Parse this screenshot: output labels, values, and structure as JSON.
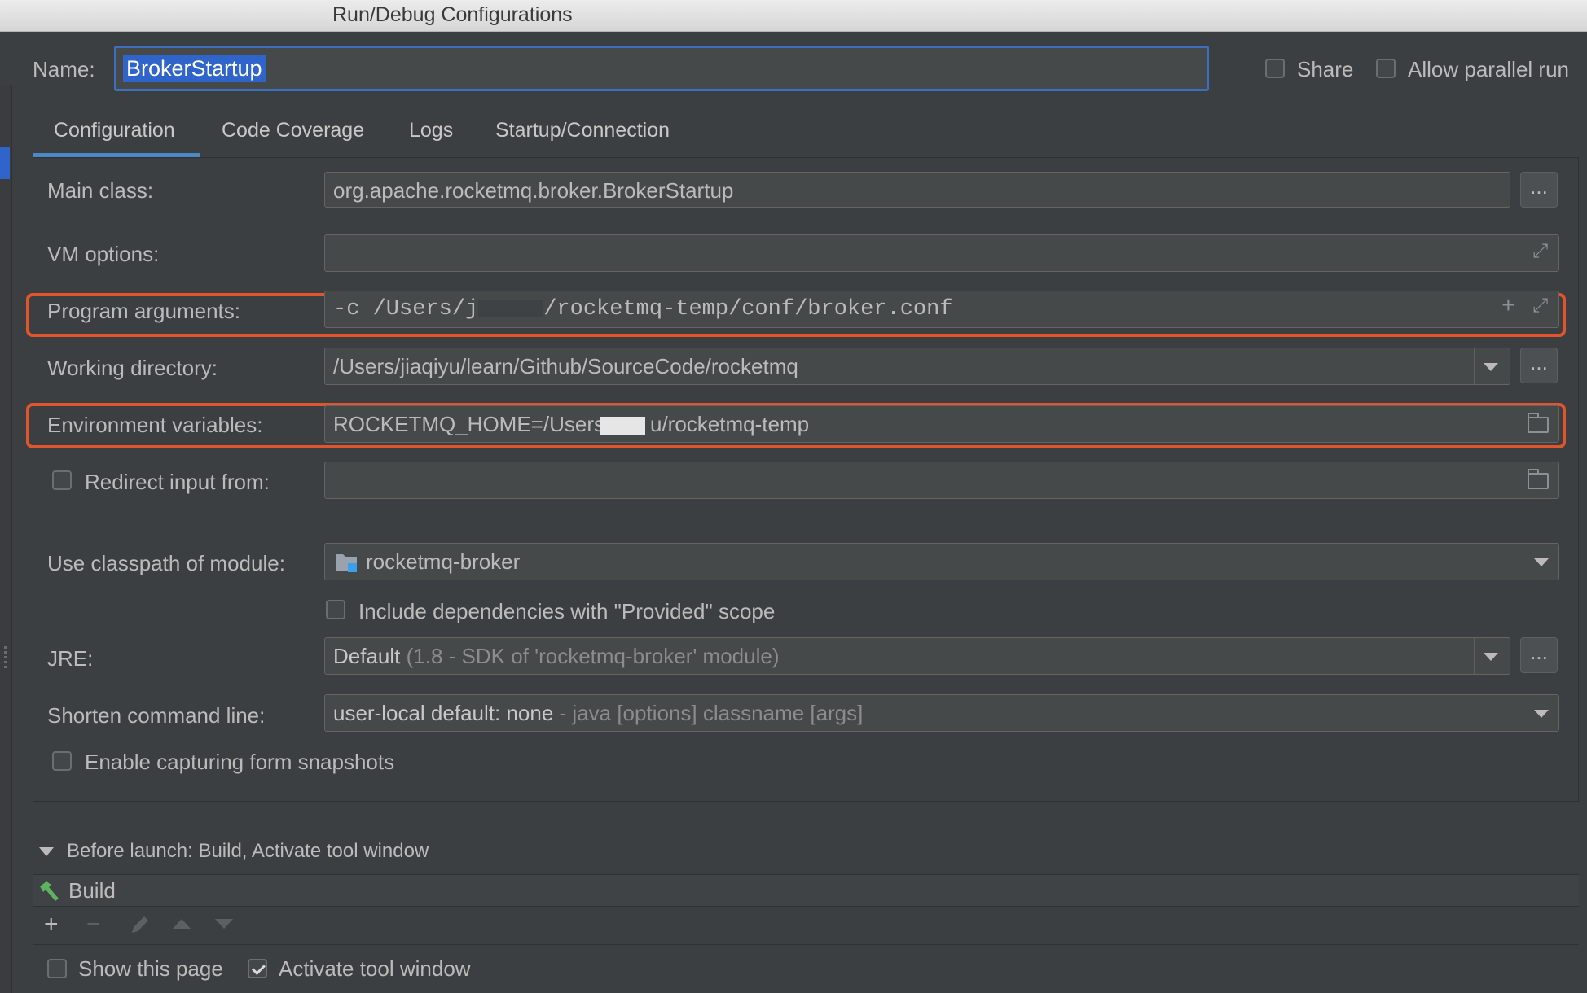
{
  "window": {
    "title": "Run/Debug Configurations"
  },
  "header": {
    "name_label": "Name:",
    "name_value": "BrokerStartup",
    "share_label": "Share",
    "share_checked": false,
    "parallel_label": "Allow parallel run",
    "parallel_checked": false
  },
  "tabs": [
    {
      "label": "Configuration",
      "active": true
    },
    {
      "label": "Code Coverage",
      "active": false
    },
    {
      "label": "Logs",
      "active": false
    },
    {
      "label": "Startup/Connection",
      "active": false
    }
  ],
  "form": {
    "main_class": {
      "label": "Main class:",
      "value": "org.apache.rocketmq.broker.BrokerStartup",
      "button": "..."
    },
    "vm_options": {
      "label": "VM options:",
      "value": ""
    },
    "program_arguments": {
      "label": "Program arguments:",
      "value_prefix": "-c /Users/j",
      "value_suffix": "/rocketmq-temp/conf/broker.conf"
    },
    "working_directory": {
      "label": "Working directory:",
      "value": "/Users/jiaqiyu/learn/Github/SourceCode/rocketmq",
      "button": "..."
    },
    "environment_variables": {
      "label": "Environment variables:",
      "value_prefix": "ROCKETMQ_HOME=/Users",
      "value_suffix": "u/rocketmq-temp"
    },
    "redirect_input": {
      "label": "Redirect input from:",
      "checked": false,
      "value": ""
    },
    "classpath_module": {
      "label": "Use classpath of module:",
      "value": "rocketmq-broker"
    },
    "include_provided": {
      "label": "Include dependencies with \"Provided\" scope",
      "checked": false
    },
    "jre": {
      "label": "JRE:",
      "value_main": "Default",
      "value_detail": "(1.8 - SDK of 'rocketmq-broker' module)",
      "button": "..."
    },
    "shorten_command_line": {
      "label": "Shorten command line:",
      "value_main": "user-local default: none",
      "value_detail": "- java [options] classname [args]"
    },
    "capture_snapshots": {
      "label": "Enable capturing form snapshots",
      "checked": false
    }
  },
  "before_launch": {
    "title": "Before launch: Build, Activate tool window",
    "items": [
      {
        "label": "Build"
      }
    ],
    "show_page_label": "Show this page",
    "show_page_checked": false,
    "activate_tool_label": "Activate tool window",
    "activate_tool_checked": true
  },
  "icons": {
    "add": "plus-icon",
    "remove": "minus-icon",
    "edit": "pencil-icon",
    "up": "arrow-up-icon",
    "down": "arrow-down-icon",
    "build": "hammer-icon",
    "module": "module-folder-icon",
    "folder": "folder-icon",
    "expand": "expand-icon"
  },
  "colors": {
    "background": "#3c3f41",
    "highlight": "#e2552c",
    "selection": "#2f65ca",
    "tab_underline": "#4a88c7"
  }
}
